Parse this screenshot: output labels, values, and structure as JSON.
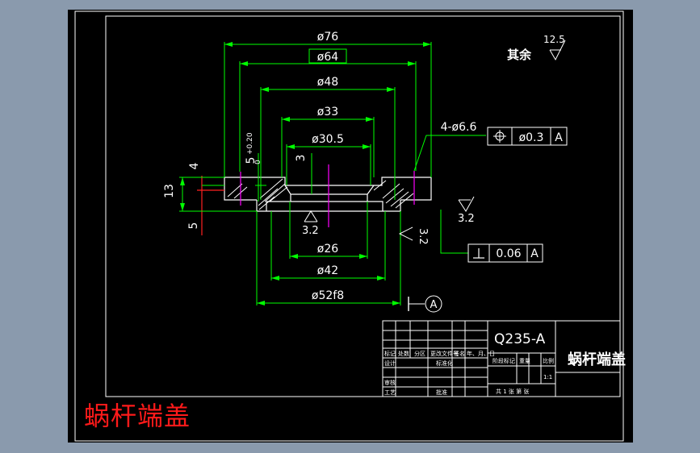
{
  "drawing": {
    "dims": {
      "d76": "ø76",
      "d64": "ø64",
      "d48": "ø48",
      "d33": "ø33",
      "d30_5": "ø30.5",
      "d26": "ø26",
      "d42": "ø42",
      "d52f8": "ø52f8",
      "h4": "4",
      "h13": "13",
      "h5": "5",
      "h5tol": "5",
      "tol_upper": "+0.20",
      "tol_lower": "0",
      "h3": "3",
      "holes": "4-ø6.6"
    },
    "position_frame": {
      "symbol": "⌖",
      "tolerance": "ø0.3",
      "datum": "A"
    },
    "perp_frame": {
      "symbol": "⊥",
      "tolerance": "0.06",
      "datum": "A"
    },
    "roughness": {
      "rest_label": "其余",
      "rest_value": "12.5",
      "r1": "3.2",
      "r2": "3.2",
      "r3": "3.2"
    },
    "datum_label": "A"
  },
  "title_block": {
    "material": "Q235-A",
    "part_name": "蜗杆端盖",
    "scale": "1:1",
    "headers": [
      "标记",
      "处数",
      "分区",
      "更改文件号",
      "签名",
      "年、月、日"
    ],
    "row_design": "设计",
    "row_standard": "标准化",
    "row_review": "审核",
    "row_process": "工艺",
    "row_approve": "批准",
    "stage_label": "阶段标记",
    "weight_label": "重量",
    "scale_label": "比例",
    "sheets_label": "共 1 张   第 张"
  },
  "caption": "蜗杆端盖",
  "colors": {
    "outline": "#ffffff",
    "dimension": "#00ff00",
    "center": "#ff00ff",
    "cut_plane": "#ff2020",
    "caption": "#ff1a1a",
    "background": "#000000",
    "window": "#8a9aad"
  }
}
